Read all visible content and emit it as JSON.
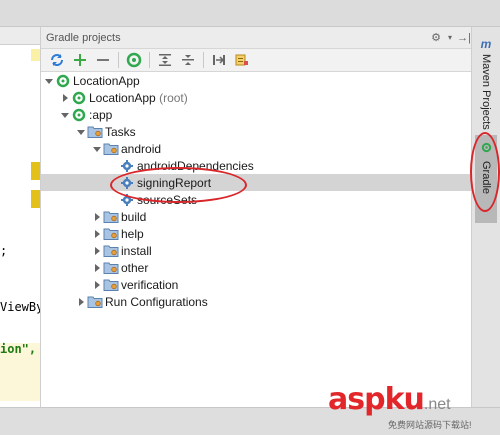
{
  "panel": {
    "title": "Gradle projects"
  },
  "toolbar": {
    "icons": [
      "refresh-icon",
      "add-icon",
      "remove-icon",
      "execute-task-icon",
      "expand-all-icon",
      "collapse-all-icon",
      "toggle-offline-icon",
      "show-dependencies-icon"
    ]
  },
  "tree": {
    "root": "LocationApp",
    "root_module": {
      "name": "LocationApp",
      "suffix": "(root)"
    },
    "app": ":app",
    "tasks": "Tasks",
    "android": "android",
    "android_tasks": [
      "androidDependencies",
      "signingReport",
      "sourceSets"
    ],
    "selected": "signingReport",
    "groups": [
      "build",
      "help",
      "install",
      "other",
      "verification"
    ],
    "run_configurations": "Run Configurations"
  },
  "right_tabs": [
    "Maven Projects",
    "Gradle"
  ],
  "editor": {
    "lines": [
      ";",
      "ViewBy",
      "ion\","
    ]
  },
  "watermark": {
    "brand": "aspku.net",
    "tagline": "免费网站源码下载站!"
  },
  "colors": {
    "selection": "#d4d4d4",
    "annotation": "#d9262a",
    "gradle_green": "#2fa84f",
    "watermark": "#e2262a"
  }
}
